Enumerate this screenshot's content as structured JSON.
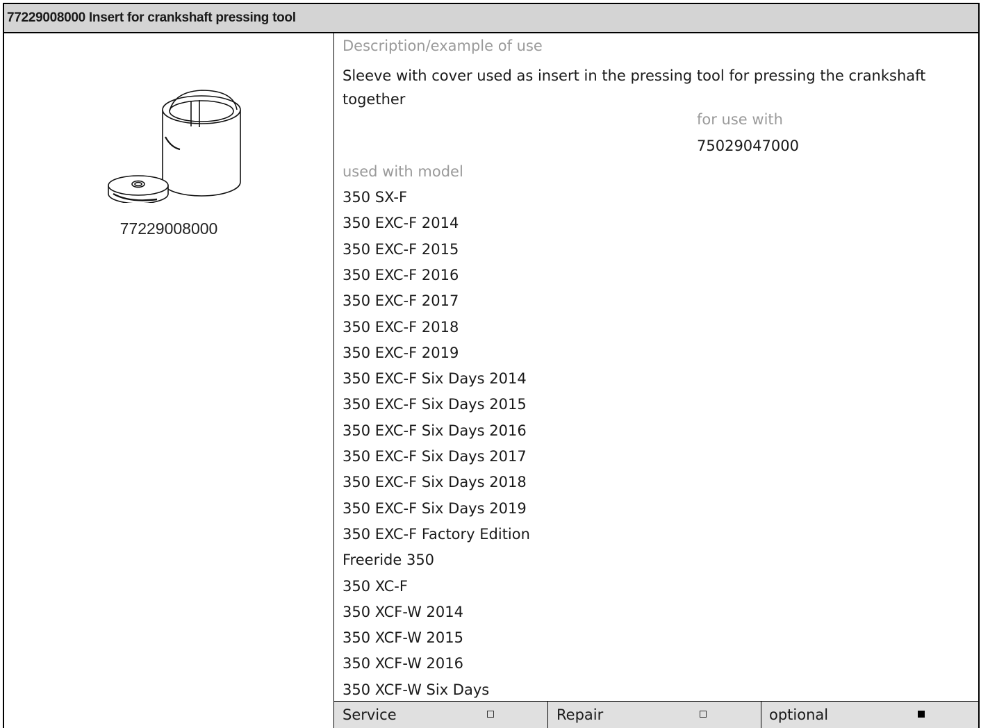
{
  "title": "77229008000 Insert for crankshaft pressing tool",
  "part_number_caption": "77229008000",
  "figure_icon": "sleeve-and-cover-drawing",
  "description_label": "Description/example of use",
  "description_text": "Sleeve with cover used as insert in the pressing tool for pressing the crankshaft together",
  "for_use_with_label": "for use with",
  "for_use_with_value": "75029047000",
  "models_label": "used with model",
  "models": [
    "350 SX-F",
    "350 EXC-F 2014",
    "350 EXC-F 2015",
    "350 EXC-F 2016",
    "350 EXC-F 2017",
    "350 EXC-F 2018",
    "350 EXC-F 2019",
    "350 EXC-F Six Days 2014",
    "350 EXC-F Six Days 2015",
    "350 EXC-F Six Days 2016",
    "350 EXC-F Six Days 2017",
    "350 EXC-F Six Days 2018",
    "350 EXC-F Six Days 2019",
    "350 EXC-F Factory Edition",
    "Freeride 350",
    "350 XC-F",
    "350 XCF-W 2014",
    "350 XCF-W 2015",
    "350 XCF-W 2016",
    "350 XCF-W Six Days"
  ],
  "footer": {
    "service_label": "Service",
    "service_checked": false,
    "repair_label": "Repair",
    "repair_checked": false,
    "optional_label": "optional",
    "optional_checked": true
  }
}
